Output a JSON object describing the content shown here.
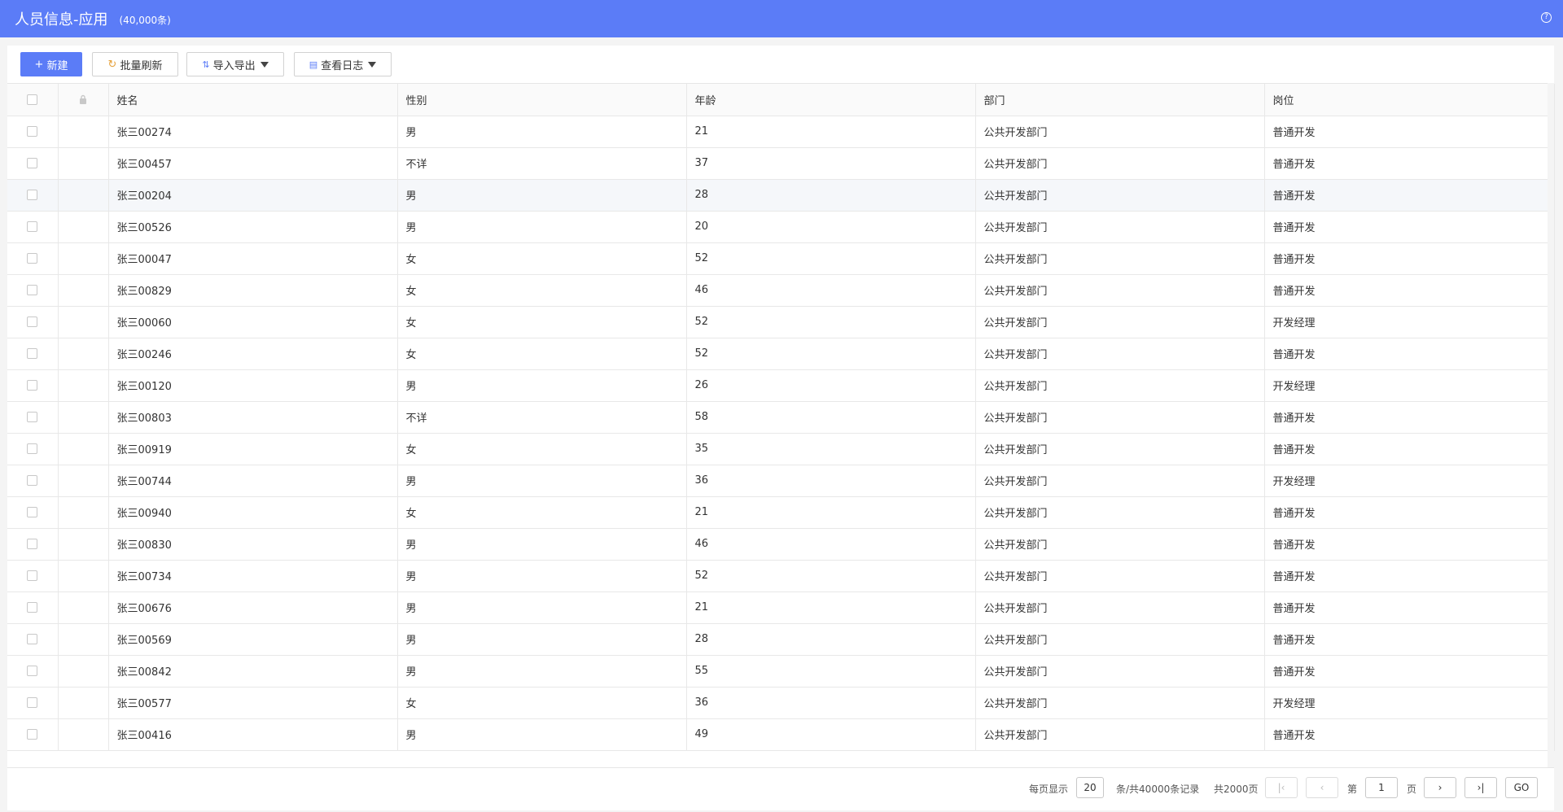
{
  "header": {
    "title": "人员信息-应用",
    "count": "(40,000条)"
  },
  "toolbar": {
    "new_label": "新建",
    "refresh_label": "批量刷新",
    "import_label": "导入导出",
    "log_label": "查看日志"
  },
  "table": {
    "columns": [
      "姓名",
      "性别",
      "年龄",
      "部门",
      "岗位"
    ],
    "rows": [
      [
        "张三00274",
        "男",
        "21",
        "公共开发部门",
        "普通开发"
      ],
      [
        "张三00457",
        "不详",
        "37",
        "公共开发部门",
        "普通开发"
      ],
      [
        "张三00204",
        "男",
        "28",
        "公共开发部门",
        "普通开发"
      ],
      [
        "张三00526",
        "男",
        "20",
        "公共开发部门",
        "普通开发"
      ],
      [
        "张三00047",
        "女",
        "52",
        "公共开发部门",
        "普通开发"
      ],
      [
        "张三00829",
        "女",
        "46",
        "公共开发部门",
        "普通开发"
      ],
      [
        "张三00060",
        "女",
        "52",
        "公共开发部门",
        "开发经理"
      ],
      [
        "张三00246",
        "女",
        "52",
        "公共开发部门",
        "普通开发"
      ],
      [
        "张三00120",
        "男",
        "26",
        "公共开发部门",
        "开发经理"
      ],
      [
        "张三00803",
        "不详",
        "58",
        "公共开发部门",
        "普通开发"
      ],
      [
        "张三00919",
        "女",
        "35",
        "公共开发部门",
        "普通开发"
      ],
      [
        "张三00744",
        "男",
        "36",
        "公共开发部门",
        "开发经理"
      ],
      [
        "张三00940",
        "女",
        "21",
        "公共开发部门",
        "普通开发"
      ],
      [
        "张三00830",
        "男",
        "46",
        "公共开发部门",
        "普通开发"
      ],
      [
        "张三00734",
        "男",
        "52",
        "公共开发部门",
        "普通开发"
      ],
      [
        "张三00676",
        "男",
        "21",
        "公共开发部门",
        "普通开发"
      ],
      [
        "张三00569",
        "男",
        "28",
        "公共开发部门",
        "普通开发"
      ],
      [
        "张三00842",
        "男",
        "55",
        "公共开发部门",
        "普通开发"
      ],
      [
        "张三00577",
        "女",
        "36",
        "公共开发部门",
        "开发经理"
      ],
      [
        "张三00416",
        "男",
        "49",
        "公共开发部门",
        "普通开发"
      ]
    ],
    "highlighted_row": 2
  },
  "pagination": {
    "per_page_label": "每页显示",
    "per_page_value": "20",
    "total_records_label": "条/共40000条记录",
    "total_pages_label": "共2000页",
    "page_prefix": "第",
    "current_page": "1",
    "page_suffix": "页",
    "go_label": "GO"
  },
  "colors": {
    "accent": "#5b7cf7"
  }
}
